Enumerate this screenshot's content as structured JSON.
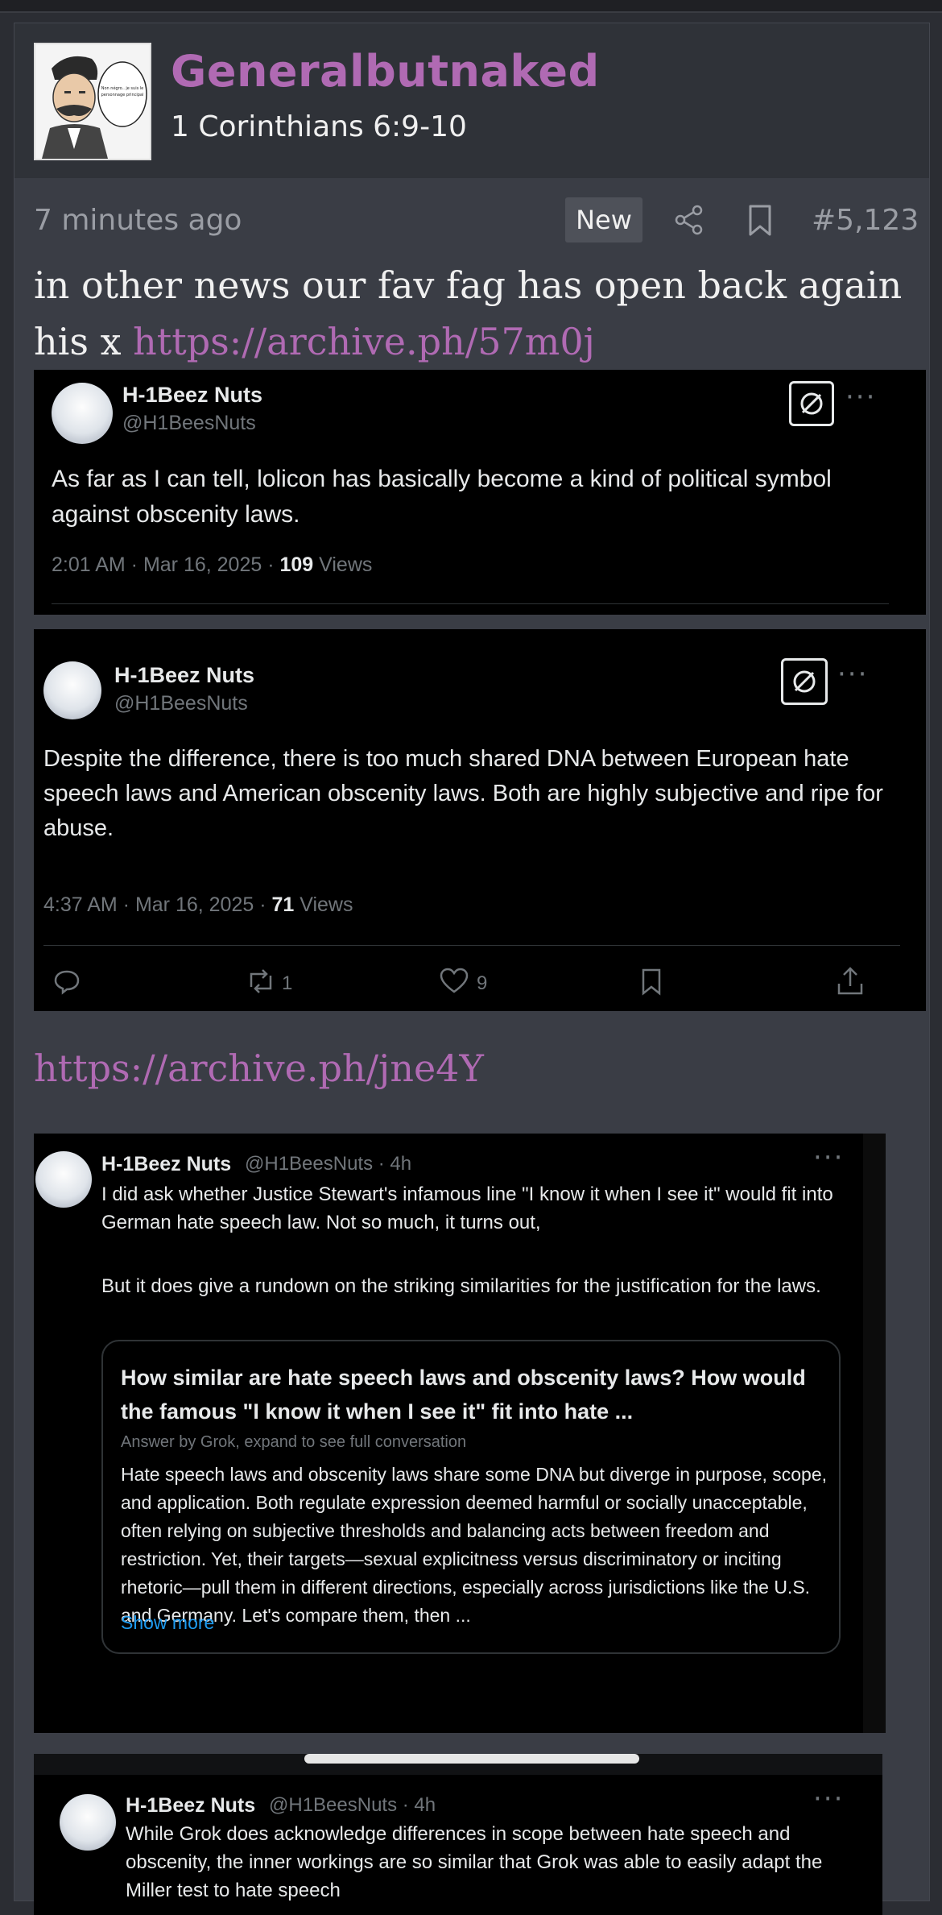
{
  "post": {
    "username": "Generalbutnaked",
    "user_title": "1 Corinthians 6:9-10",
    "avatar_caption": "Non négro.. je suis le personnage principal",
    "time": "7 minutes ago",
    "new_badge": "New",
    "post_number": "#5,123",
    "text": "in other news our fav fag has open back again his x",
    "link1": "https://archive.ph/57m0j",
    "link2": "https://archive.ph/jne4Y"
  },
  "tweets": [
    {
      "name": "H-1Beez Nuts",
      "handle": "@H1BeesNuts",
      "text": "As far as I can tell, lolicon has basically become a kind of political symbol against obscenity laws.",
      "time": "2:01 AM · Mar 16, 2025 · ",
      "views_count": "109",
      "views_label": " Views"
    },
    {
      "name": "H-1Beez Nuts",
      "handle": "@H1BeesNuts",
      "text": "Despite the difference, there is too much shared DNA between European hate speech laws and American obscenity laws. Both are highly subjective and ripe for abuse.",
      "time": "4:37 AM · Mar 16, 2025 · ",
      "views_count": "71",
      "views_label": " Views",
      "retweets": "1",
      "likes": "9"
    },
    {
      "name": "H-1Beez Nuts",
      "handle": "@H1BeesNuts · 4h",
      "text1": "I did ask whether Justice Stewart's infamous line \"I know it when I see it\" would fit into German hate speech law. Not so much, it turns out,",
      "text2": "But it does give a rundown on the striking similarities for the justification for the laws.",
      "card_title": "How similar are hate speech laws and obscenity laws? How would the famous \"I know it when I see it\" fit into hate ...",
      "card_sub": "Answer by Grok, expand to see full conversation",
      "card_body": "Hate speech laws and obscenity laws share some DNA but diverge in purpose, scope, and application. Both regulate expression deemed harmful or socially unacceptable, often relying on subjective thresholds and balancing acts between freedom and restriction. Yet, their targets—sexual explicitness versus discriminatory or inciting rhetoric—pull them in different directions, especially across jurisdictions like the U.S. and Germany. Let's compare them, then ...",
      "show_more": "Show more"
    },
    {
      "name": "H-1Beez Nuts",
      "handle": "@H1BeesNuts · 4h",
      "text": "While Grok does acknowledge differences in scope between hate speech and obscenity, the inner workings are so similar that Grok was able to easily adapt the Miller test to hate speech"
    }
  ]
}
